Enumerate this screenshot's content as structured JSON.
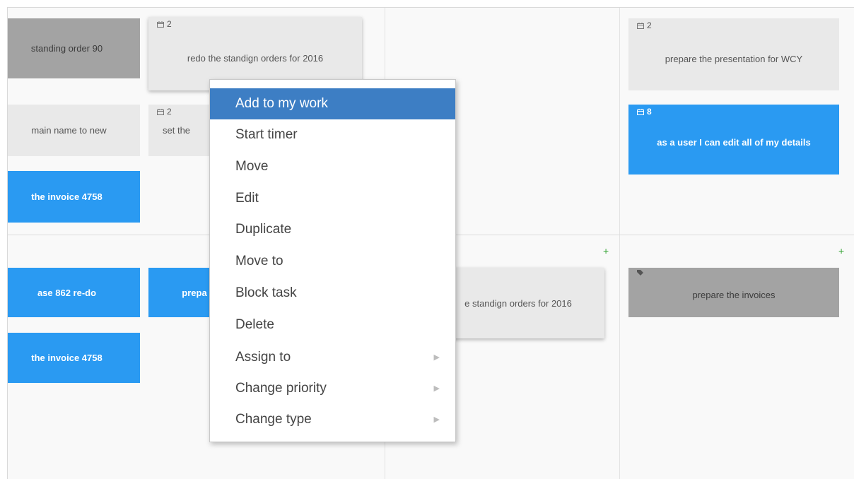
{
  "board": {
    "cards": [
      {
        "text": "standing order 90",
        "style": "grey"
      },
      {
        "count": "2",
        "text": "redo the standign orders for 2016",
        "style": "light"
      },
      {
        "count": "2",
        "text": "prepare the presentation for WCY",
        "style": "light"
      },
      {
        "text": "main name to new",
        "style": "light"
      },
      {
        "count": "2",
        "text": "set the",
        "style": "light"
      },
      {
        "count": "8",
        "text": "as a user I can edit all of my details",
        "style": "blue"
      },
      {
        "text": "the invoice 4758",
        "style": "blue"
      },
      {
        "text": "ase 862 re-do",
        "style": "blue"
      },
      {
        "text": "prepa",
        "style": "blue"
      },
      {
        "text": "e standign orders for 2016",
        "style": "light"
      },
      {
        "text": "prepare the invoices",
        "style": "grey"
      },
      {
        "text": "the invoice 4758",
        "style": "blue"
      }
    ],
    "add_symbol": "+"
  },
  "context_menu": {
    "items": [
      {
        "label": "Add to my work",
        "highlighted": true
      },
      {
        "label": "Start timer"
      },
      {
        "label": "Move"
      },
      {
        "label": "Edit"
      },
      {
        "label": "Duplicate"
      },
      {
        "label": "Move to"
      },
      {
        "label": "Block task"
      },
      {
        "label": "Delete"
      },
      {
        "label": "Assign to",
        "submenu": true
      },
      {
        "label": "Change priority",
        "submenu": true
      },
      {
        "label": "Change type",
        "submenu": true
      }
    ],
    "submenu_arrow": "▶"
  },
  "colors": {
    "card_blue": "#2a9af2",
    "card_light": "#e9e9e9",
    "card_grey": "#a3a3a3",
    "menu_highlight": "#3d7ec4",
    "plus_green": "#3aa63a"
  },
  "icons": [
    "calendar-icon",
    "tag-icon",
    "plus-icon",
    "submenu-arrow-icon"
  ]
}
